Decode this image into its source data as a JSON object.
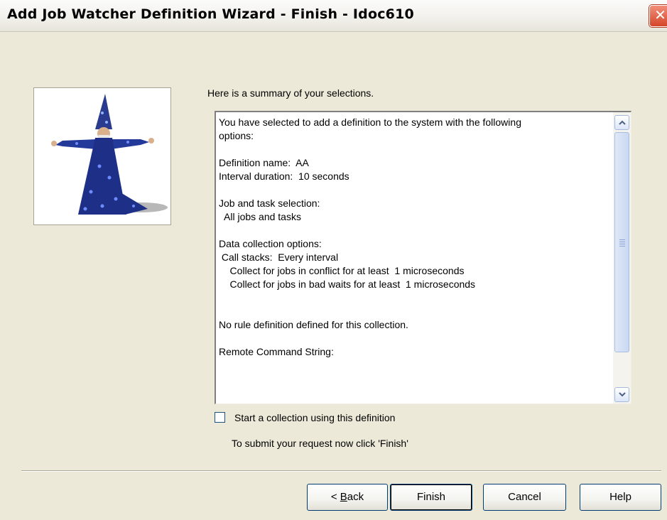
{
  "window": {
    "title": "Add Job Watcher Definition Wizard - Finish - Idoc610",
    "close_symbol": "✕"
  },
  "summary": {
    "intro": "Here is a summary of your selections.",
    "lines": [
      "You have selected to add a definition to the system with the following",
      "options:",
      "",
      "Definition name:  AA",
      "Interval duration:  10 seconds",
      "",
      "Job and task selection:",
      "  All jobs and tasks",
      "",
      "Data collection options:",
      " Call stacks:  Every interval",
      "    Collect for jobs in conflict for at least  1 microseconds",
      "    Collect for jobs in bad waits for at least  1 microseconds",
      "",
      "",
      "No rule definition defined for this collection.",
      "",
      "Remote Command String:"
    ]
  },
  "start_collection": {
    "label": "Start a collection using this definition",
    "checked": false
  },
  "submit_note": "To submit your request now click 'Finish'",
  "buttons": {
    "back_prefix": "< ",
    "back_mnemonic": "B",
    "back_rest": "ack",
    "finish": "Finish",
    "cancel": "Cancel",
    "help": "Help"
  },
  "icons": {
    "close": "close-icon",
    "wizard": "wizard-image",
    "scroll_up": "arrow-up-icon",
    "scroll_down": "arrow-down-icon"
  },
  "colors": {
    "dialog_bg": "#ece9d8",
    "close_red": "#d4462a",
    "button_border": "#003c74"
  }
}
